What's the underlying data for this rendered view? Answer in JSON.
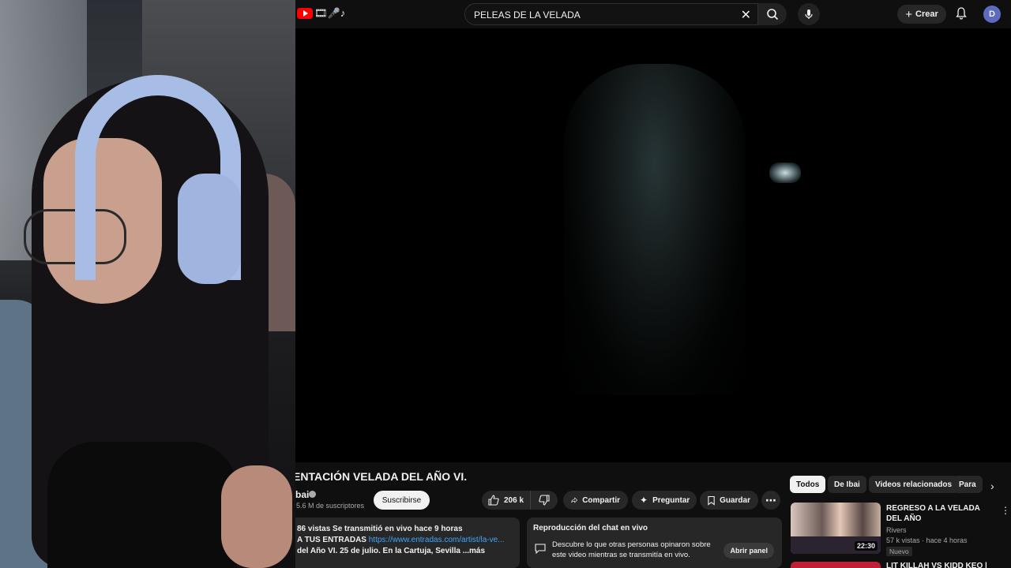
{
  "masthead": {
    "search_value": "PELEAS DE LA VELADA",
    "create_label": "Crear",
    "avatar_letter": "D"
  },
  "video": {
    "title": "ENTACIÓN VELADA DEL AÑO VI.",
    "channel": "bai",
    "subscribers": "5.6 M de suscriptores",
    "subscribe_label": "Suscribirse",
    "likes": "206 k",
    "share_label": "Compartir",
    "ask_label": "Preguntar",
    "save_label": "Guardar"
  },
  "description": {
    "line1_views": "86 vistas",
    "line1_rest": "Se transmitió en vivo hace 9 horas",
    "line2_prefix": "A TUS ENTRADAS",
    "line2_link": "https://www.entradas.com/artist/la-ve...",
    "line3": "del Año VI. 25 de julio. En la Cartuja, Sevilla",
    "more": "...más"
  },
  "chat": {
    "title": "Reproducción del chat en vivo",
    "desc": "Descubre lo que otras personas opinaron sobre este video mientras se transmitía en vivo.",
    "button": "Abrir panel"
  },
  "chips": [
    "Todos",
    "De Ibai",
    "Videos relacionados",
    "Para"
  ],
  "recommendations": [
    {
      "title": "REGRESO A LA VELADA DEL AÑO",
      "channel": "Rivers",
      "meta": "57 k vistas · hace 4 horas",
      "badge": "Nuevo",
      "duration": "22:30"
    },
    {
      "title": "LIT KILLAH VS KIDD KEO |"
    }
  ],
  "colors": {
    "accent": "#ff0000",
    "link": "#3ea6ff",
    "background": "#0f0f0f"
  }
}
